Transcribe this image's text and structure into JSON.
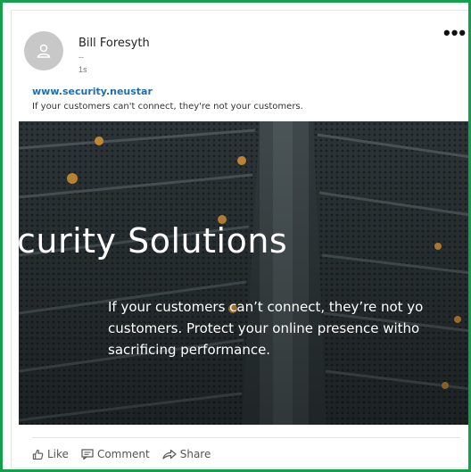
{
  "post": {
    "author_name": "Bill Foresyth",
    "author_headline": "--",
    "timestamp": "1s",
    "more_menu": "•••",
    "link_url": "www.security.neustar",
    "link_description": "If your customers can't connect, they're not your customers.",
    "hero": {
      "title": "curity Solutions",
      "body_line1": "If your customers can’t connect, they’re not yo",
      "body_line2": "customers. Protect your online presence witho",
      "body_line3": "sacrificing performance."
    },
    "actions": {
      "like": "Like",
      "comment": "Comment",
      "share": "Share"
    }
  },
  "colors": {
    "frame_border": "#14a04a",
    "link": "#1d6fb0",
    "hero_background": "#2a3133"
  },
  "icons": {
    "avatar": "person-icon",
    "like": "thumbs-up-icon",
    "comment": "comment-icon",
    "share": "share-arrow-icon"
  }
}
